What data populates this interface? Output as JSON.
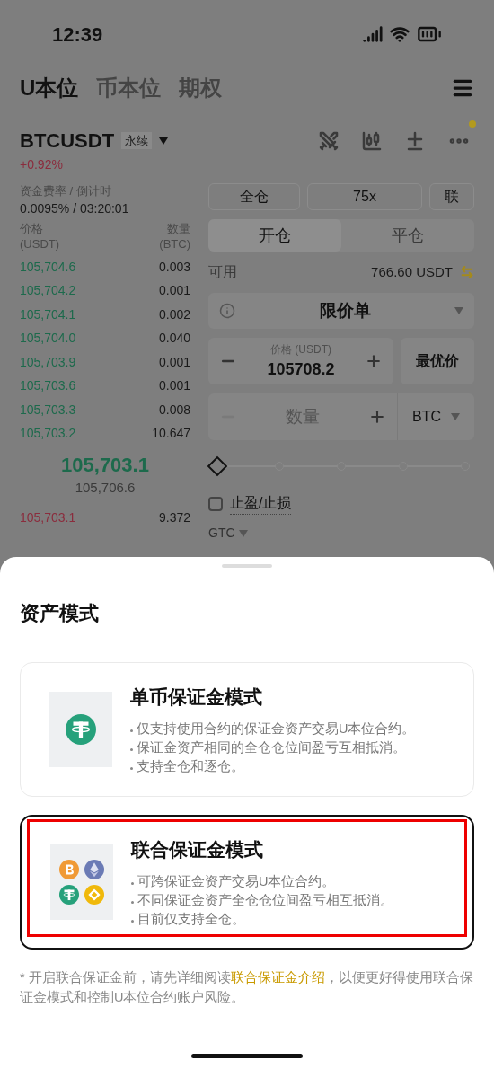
{
  "status_bar": {
    "time": "12:39"
  },
  "top_tabs": [
    {
      "label": "U本位",
      "selected": true
    },
    {
      "label": "币本位",
      "selected": false
    },
    {
      "label": "期权",
      "selected": false
    }
  ],
  "ticker": {
    "symbol": "BTCUSDT",
    "badge": "永续",
    "change": "+0.92%"
  },
  "funding": {
    "label": "资金费率 / 倒计时",
    "value": "0.0095% / 03:20:01"
  },
  "margin_buttons": [
    "全仓",
    "75x",
    "联"
  ],
  "order_book": {
    "price_header": "价格",
    "price_unit": "(USDT)",
    "qty_header": "数量",
    "qty_unit": "(BTC)",
    "rows_top": [
      {
        "price": "105,704.6",
        "qty": "0.003",
        "kind": "buy"
      },
      {
        "price": "105,704.2",
        "qty": "0.001",
        "kind": "buy"
      },
      {
        "price": "105,704.1",
        "qty": "0.002",
        "kind": "buy"
      },
      {
        "price": "105,704.0",
        "qty": "0.040",
        "kind": "buy"
      },
      {
        "price": "105,703.9",
        "qty": "0.001",
        "kind": "buy"
      },
      {
        "price": "105,703.6",
        "qty": "0.001",
        "kind": "buy"
      },
      {
        "price": "105,703.3",
        "qty": "0.008",
        "kind": "buy"
      },
      {
        "price": "105,703.2",
        "qty": "10.647",
        "kind": "buy"
      }
    ],
    "last_price": "105,703.1",
    "mark_price": "105,706.6",
    "rows_bottom": [
      {
        "price": "105,703.1",
        "qty": "9.372",
        "kind": "sell"
      }
    ]
  },
  "position_tabs": [
    {
      "label": "开仓",
      "selected": true
    },
    {
      "label": "平仓",
      "selected": false
    }
  ],
  "available": {
    "label": "可用",
    "value": "766.60 USDT"
  },
  "order_type": "限价单",
  "price_field": {
    "label": "价格 (USDT)",
    "value": "105708.2"
  },
  "best_price_button": "最优价",
  "quantity_field": {
    "placeholder": "数量",
    "unit": "BTC"
  },
  "slider": {
    "level": 0
  },
  "tp_sl": {
    "label": "止盈/止损",
    "checked": false
  },
  "time_in_force": "GTC",
  "sheet": {
    "title": "资产模式",
    "options": [
      {
        "kind": "single",
        "title": "单币保证金模式",
        "selected": false,
        "highlighted": false,
        "bullets": [
          "仅支持使用合约的保证金资产交易U本位合约。",
          "保证金资产相同的全仓仓位间盈亏互相抵消。",
          "支持全仓和逐仓。"
        ]
      },
      {
        "kind": "multi",
        "title": "联合保证金模式",
        "selected": true,
        "highlighted": true,
        "bullets": [
          "可跨保证金资产交易U本位合约。",
          "不同保证金资产全仓仓位间盈亏相互抵消。",
          "目前仅支持全仓。"
        ]
      }
    ],
    "note_before": "* 开启联合保证金前，请先详细阅读",
    "note_link": "联合保证金介绍",
    "note_after": "，以便更好得使用联合保证金模式和控制U本位合约账户风险。"
  }
}
